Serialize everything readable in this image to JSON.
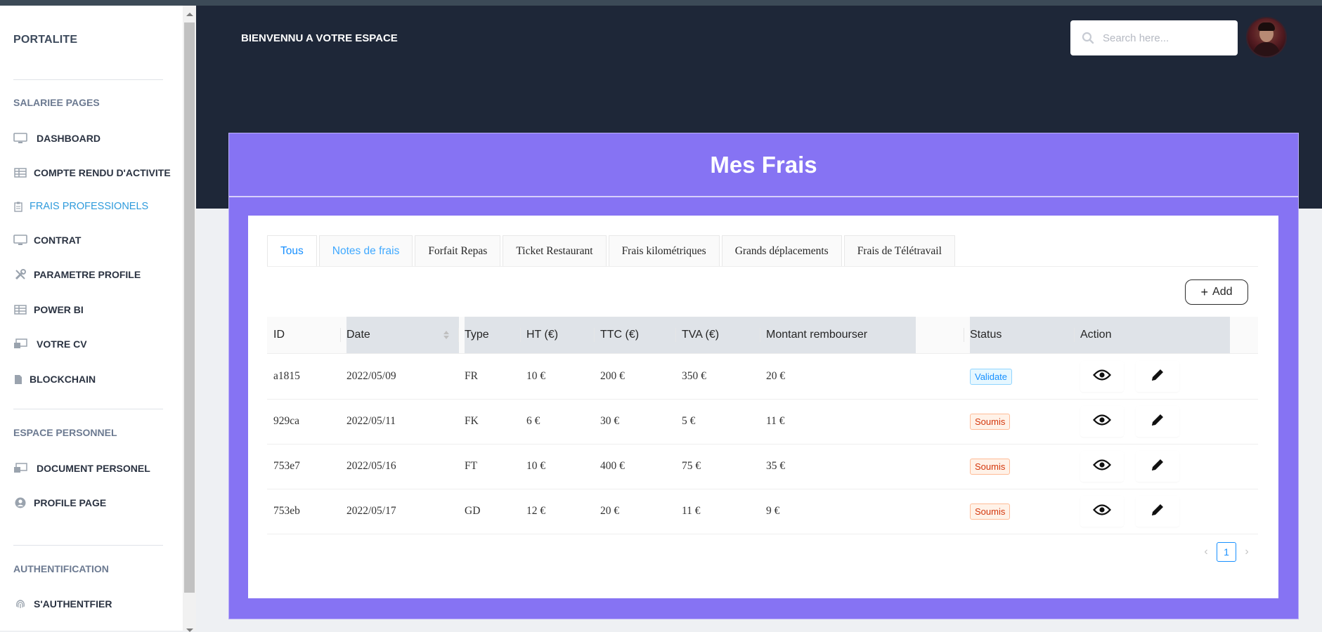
{
  "sidebar": {
    "brand": "PORTALITE",
    "sections": [
      "SALARIEE PAGES",
      "ESPACE PERSONNEL",
      "AUTHENTIFICATION"
    ],
    "items": [
      {
        "label": "DASHBOARD",
        "icon": "monitor-icon"
      },
      {
        "label": "COMPTE RENDU D'ACTIVITE",
        "icon": "table-icon"
      },
      {
        "label": "FRAIS PROFESSIONELS",
        "icon": "clipboard-icon",
        "active": true
      },
      {
        "label": "CONTRAT",
        "icon": "monitor-icon"
      },
      {
        "label": "PARAMETRE PROFILE",
        "icon": "tools-icon"
      },
      {
        "label": "POWER BI",
        "icon": "table-icon"
      },
      {
        "label": "VOTRE CV",
        "icon": "screen-share-icon"
      },
      {
        "label": "BLOCKCHAIN",
        "icon": "file-icon"
      },
      {
        "label": "DOCUMENT PERSONEL",
        "icon": "screen-share-icon"
      },
      {
        "label": "PROFILE PAGE",
        "icon": "user-circle-icon"
      },
      {
        "label": "S'AUTHENTFIER",
        "icon": "fingerprint-icon"
      }
    ]
  },
  "header": {
    "welcome": "BIENVENNU A VOTRE ESPACE",
    "search_placeholder": "Search here..."
  },
  "card": {
    "title": "Mes Frais",
    "tabs": [
      "Tous",
      "Notes de frais",
      "Forfait Repas",
      "Ticket Restaurant",
      "Frais kilométriques",
      "Grands déplacements",
      "Frais de Télétravail"
    ],
    "active_tab": "Tous",
    "add_label": "Add"
  },
  "table": {
    "columns": [
      "ID",
      "Date",
      "Type",
      "HT (€)",
      "TTC (€)",
      "TVA (€)",
      "Montant rembourser",
      "Status",
      "Action"
    ],
    "rows": [
      {
        "id": "a1815",
        "date": "2022/05/09",
        "type": "FR",
        "ht": "10 €",
        "ttc": "200 €",
        "tva": "350 €",
        "montant": "20 €",
        "status": "Validate"
      },
      {
        "id": "929ca",
        "date": "2022/05/11",
        "type": "FK",
        "ht": "6 €",
        "ttc": "30 €",
        "tva": "5 €",
        "montant": "11 €",
        "status": "Soumis"
      },
      {
        "id": "753e7",
        "date": "2022/05/16",
        "type": "FT",
        "ht": "10 €",
        "ttc": "400 €",
        "tva": "75 €",
        "montant": "35 €",
        "status": "Soumis"
      },
      {
        "id": "753eb",
        "date": "2022/05/17",
        "type": "GD",
        "ht": "12 €",
        "ttc": "20 €",
        "tva": "11 €",
        "montant": "9 €",
        "status": "Soumis"
      }
    ]
  },
  "pagination": {
    "current": "1"
  },
  "colors": {
    "header_bg": "#1e2738",
    "card_bg": "#8673f3",
    "accent": "#1890ff",
    "active_nav": "#2f9bdc"
  }
}
